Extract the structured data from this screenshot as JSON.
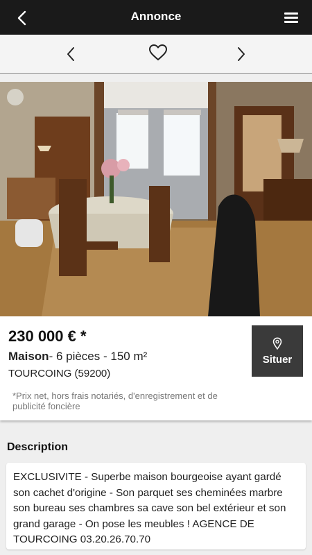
{
  "header": {
    "title": "Annonce",
    "back_icon": "chevron-left-icon",
    "menu_icon": "hamburger-menu-icon"
  },
  "nav": {
    "prev_icon": "chevron-left-icon",
    "favorite_icon": "heart-outline-icon",
    "next_icon": "chevron-right-icon"
  },
  "photo": {
    "alt": "Salle à manger",
    "carousel_dots": 1
  },
  "listing": {
    "price": "230 000 € *",
    "type": "Maison",
    "details": "- 6 pièces - 150 m²",
    "city": "TOURCOING (59200)",
    "note": "*Prix net, hors frais notariés, d'enregistrement et de publicité foncière",
    "locate_label": "Situer",
    "locate_icon": "map-pin-icon"
  },
  "description": {
    "title": "Description",
    "text": "EXCLUSIVITE - Superbe maison bourgeoise ayant gardé son cachet d'origine - Son parquet ses cheminées marbre son bureau ses chambres sa cave son bel extérieur et son grand garage - On pose les meubles ! AGENCE DE TOURCOING 03.20.26.70.70"
  },
  "colors": {
    "topbar": "#1a1a1a",
    "button_dark": "#3a3a3a",
    "page_bg": "#efefef"
  }
}
